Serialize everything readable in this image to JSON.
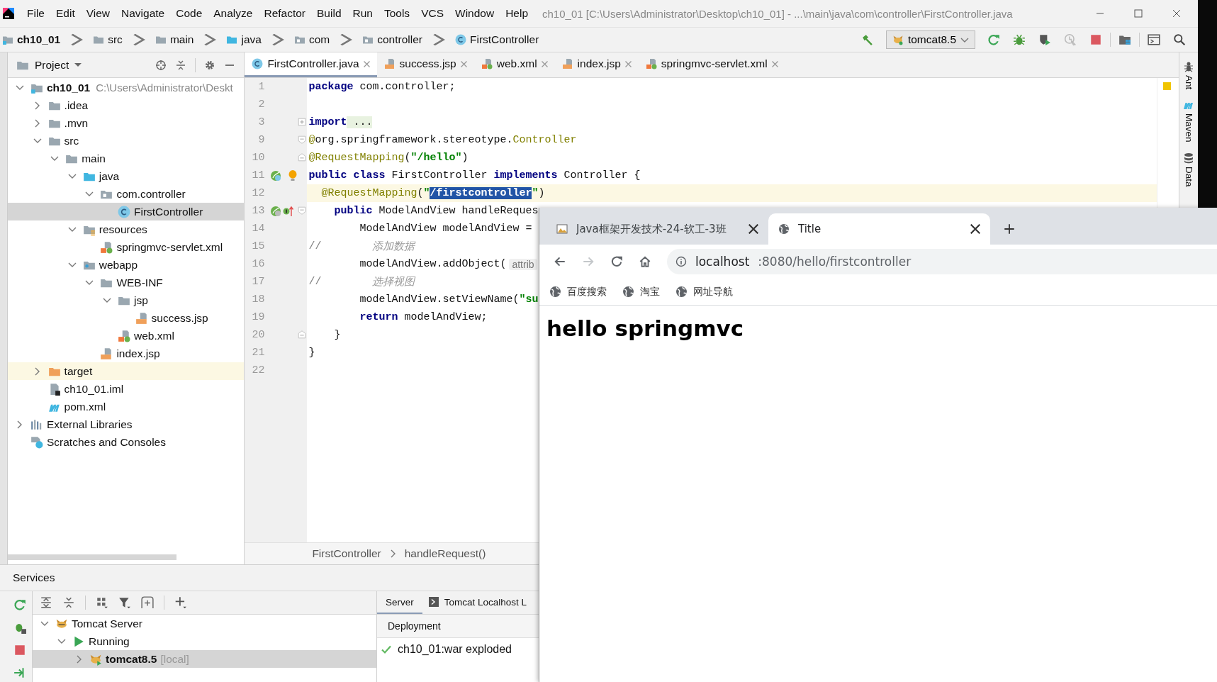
{
  "menu_bar": {
    "items": [
      "File",
      "Edit",
      "View",
      "Navigate",
      "Code",
      "Analyze",
      "Refactor",
      "Build",
      "Run",
      "Tools",
      "VCS",
      "Window",
      "Help"
    ],
    "title": "ch10_01 [C:\\Users\\Administrator\\Desktop\\ch10_01] - ...\\main\\java\\com\\controller\\FirstController.java"
  },
  "nav_bar": {
    "crumbs": [
      {
        "label": "ch10_01",
        "kind": "module"
      },
      {
        "label": "src",
        "kind": "folder"
      },
      {
        "label": "main",
        "kind": "folder"
      },
      {
        "label": "java",
        "kind": "src"
      },
      {
        "label": "com",
        "kind": "package"
      },
      {
        "label": "controller",
        "kind": "package"
      },
      {
        "label": "FirstController",
        "kind": "class"
      }
    ],
    "run_config": "tomcat8.5"
  },
  "project_panel": {
    "title": "Project",
    "tree": [
      {
        "label": "ch10_01",
        "note": "C:\\Users\\Administrator\\Deskt",
        "kind": "module",
        "expanded": true,
        "selected": false,
        "excluded": false,
        "children": [
          {
            "label": ".idea",
            "kind": "folder",
            "expanded": false,
            "selected": false,
            "excluded": false
          },
          {
            "label": ".mvn",
            "kind": "folder",
            "expanded": false,
            "selected": false,
            "excluded": false
          },
          {
            "label": "src",
            "kind": "folder",
            "expanded": true,
            "selected": false,
            "excluded": false,
            "children": [
              {
                "label": "main",
                "kind": "folder",
                "expanded": true,
                "selected": false,
                "excluded": false,
                "children": [
                  {
                    "label": "java",
                    "kind": "src",
                    "expanded": true,
                    "selected": false,
                    "excluded": false,
                    "children": [
                      {
                        "label": "com.controller",
                        "kind": "package",
                        "expanded": true,
                        "selected": false,
                        "excluded": false,
                        "children": [
                          {
                            "label": "FirstController",
                            "kind": "class",
                            "selected": true,
                            "excluded": false
                          }
                        ]
                      }
                    ]
                  },
                  {
                    "label": "resources",
                    "kind": "resources",
                    "expanded": true,
                    "selected": false,
                    "excluded": false,
                    "children": [
                      {
                        "label": "springmvc-servlet.xml",
                        "kind": "xml",
                        "selected": false,
                        "excluded": false
                      }
                    ]
                  },
                  {
                    "label": "webapp",
                    "kind": "webapp",
                    "expanded": true,
                    "selected": false,
                    "excluded": false,
                    "children": [
                      {
                        "label": "WEB-INF",
                        "kind": "folder",
                        "expanded": true,
                        "selected": false,
                        "excluded": false,
                        "children": [
                          {
                            "label": "jsp",
                            "kind": "folder",
                            "expanded": true,
                            "selected": false,
                            "excluded": false,
                            "children": [
                              {
                                "label": "success.jsp",
                                "kind": "jsp",
                                "selected": false,
                                "excluded": false
                              }
                            ]
                          },
                          {
                            "label": "web.xml",
                            "kind": "xml",
                            "selected": false,
                            "excluded": false
                          }
                        ]
                      },
                      {
                        "label": "index.jsp",
                        "kind": "jsp",
                        "selected": false,
                        "excluded": false
                      }
                    ]
                  }
                ]
              }
            ]
          },
          {
            "label": "target",
            "kind": "target",
            "expanded": false,
            "selected": false,
            "excluded": true
          },
          {
            "label": "ch10_01.iml",
            "kind": "iml",
            "selected": false,
            "excluded": false
          },
          {
            "label": "pom.xml",
            "kind": "maven",
            "selected": false,
            "excluded": false
          }
        ]
      },
      {
        "label": "External Libraries",
        "kind": "libraries",
        "expanded": false,
        "selected": false,
        "excluded": false
      },
      {
        "label": "Scratches and Consoles",
        "kind": "scratches",
        "selected": false,
        "excluded": false
      }
    ]
  },
  "editor": {
    "tabs": [
      {
        "label": "FirstController.java",
        "kind": "class",
        "selected": true
      },
      {
        "label": "success.jsp",
        "kind": "jsp",
        "selected": false
      },
      {
        "label": "web.xml",
        "kind": "xml",
        "selected": false
      },
      {
        "label": "index.jsp",
        "kind": "jsp",
        "selected": false
      },
      {
        "label": "springmvc-servlet.xml",
        "kind": "xml",
        "selected": false
      }
    ],
    "lines": [
      {
        "num": "1",
        "tokens": [
          {
            "kind": "kw",
            "text": "package"
          },
          {
            "kind": "pl",
            "text": " com.controller;"
          }
        ]
      },
      {
        "num": "2"
      },
      {
        "num": "3",
        "markers": [
          {
            "kind": "fold-plus"
          }
        ],
        "tokens": [
          {
            "kind": "kw",
            "text": "import"
          },
          {
            "kind": "folded",
            "text": " ..."
          }
        ]
      },
      {
        "num": "9",
        "markers": [
          {
            "kind": "fold-open"
          }
        ],
        "tokens": [
          {
            "kind": "ann",
            "text": "@"
          },
          {
            "kind": "pl",
            "text": "org.springframework.stereotype."
          },
          {
            "kind": "ann",
            "text": "Controller"
          }
        ]
      },
      {
        "num": "10",
        "markers": [
          {
            "kind": "fold-end"
          }
        ],
        "tokens": [
          {
            "kind": "ann",
            "text": "@RequestMapping"
          },
          {
            "kind": "pl",
            "text": "("
          },
          {
            "kind": "str",
            "text": "\"/hello\""
          },
          {
            "kind": "pl",
            "text": ")"
          }
        ]
      },
      {
        "num": "11",
        "bulb": true,
        "markers": [
          {
            "kind": "bean"
          }
        ],
        "tokens": [
          {
            "kind": "kw",
            "text": "public"
          },
          {
            "kind": "kw",
            "text": " class"
          },
          {
            "kind": "pl",
            "text": " FirstController "
          },
          {
            "kind": "kw",
            "text": "implements"
          },
          {
            "kind": "pl",
            "text": " Controller {"
          }
        ]
      },
      {
        "num": "12",
        "current": true,
        "tokens": [
          {
            "kind": "ann",
            "text": "  @RequestMapping"
          },
          {
            "kind": "pl",
            "text": "("
          },
          {
            "kind": "str",
            "text": "\""
          },
          {
            "kind": "sel",
            "text": "/firstcontroller"
          },
          {
            "kind": "str",
            "text": "\""
          },
          {
            "kind": "pl",
            "text": ")"
          }
        ]
      },
      {
        "num": "13",
        "markers": [
          {
            "kind": "bean-impl"
          },
          {
            "kind": "implements"
          },
          {
            "kind": "fold-open"
          }
        ],
        "tokens": [
          {
            "kind": "kw",
            "text": "    public"
          },
          {
            "kind": "pl",
            "text": " ModelAndView handleReques"
          }
        ]
      },
      {
        "num": "14",
        "tokens": [
          {
            "kind": "pl",
            "text": "        ModelAndView modelAndView ="
          }
        ]
      },
      {
        "num": "15",
        "tokens": [
          {
            "kind": "cmt",
            "text": "//        "
          },
          {
            "kind": "cmtcn",
            "text": "添加数据"
          }
        ]
      },
      {
        "num": "16",
        "tokens": [
          {
            "kind": "pl",
            "text": "        modelAndView.addObject("
          },
          {
            "kind": "hint",
            "text": "attrib"
          }
        ]
      },
      {
        "num": "17",
        "tokens": [
          {
            "kind": "cmt",
            "text": "//        "
          },
          {
            "kind": "cmtcn",
            "text": "选择视图"
          }
        ]
      },
      {
        "num": "18",
        "tokens": [
          {
            "kind": "pl",
            "text": "        modelAndView.setViewName("
          },
          {
            "kind": "str",
            "text": "\"su"
          }
        ]
      },
      {
        "num": "19",
        "tokens": [
          {
            "kind": "kw",
            "text": "        return"
          },
          {
            "kind": "pl",
            "text": " modelAndView;"
          }
        ]
      },
      {
        "num": "20",
        "markers": [
          {
            "kind": "fold-end"
          }
        ],
        "tokens": [
          {
            "kind": "pl",
            "text": "    }"
          }
        ]
      },
      {
        "num": "21",
        "tokens": [
          {
            "kind": "pl",
            "text": "}"
          }
        ]
      },
      {
        "num": "22"
      }
    ],
    "breadcrumb": [
      "FirstController",
      "handleRequest()"
    ]
  },
  "side_tools": [
    {
      "label": "Ant",
      "kind": "ant"
    },
    {
      "label": "Maven",
      "kind": "maven"
    },
    {
      "label": "Data",
      "kind": "database"
    }
  ],
  "services": {
    "title": "Services",
    "tree": [
      {
        "label": "Tomcat Server",
        "kind": "tomcat",
        "expanded": true,
        "selected": false,
        "children": [
          {
            "label": "Running",
            "kind": "run",
            "expanded": true,
            "selected": false,
            "children": [
              {
                "label": "tomcat8.5",
                "note": "[local]",
                "kind": "tomcat-run",
                "expanded": false,
                "selected": true
              }
            ]
          }
        ]
      }
    ],
    "tabs": [
      {
        "label": "Server",
        "kind": "plain",
        "selected": true
      },
      {
        "label": "Tomcat Localhost L",
        "kind": "console",
        "selected": false
      }
    ],
    "deployment_header": "Deployment",
    "deployments": [
      "ch10_01:war exploded"
    ]
  },
  "browser": {
    "tabs": [
      {
        "title": "Java框架开发技术-24-软工-3班",
        "kind": "picture",
        "selected": false
      },
      {
        "title": "Title",
        "kind": "globe",
        "selected": true
      }
    ],
    "address_host": "localhost",
    "address_path": ":8080/hello/firstcontroller",
    "bookmarks": [
      "百度搜索",
      "淘宝",
      "网址导航"
    ],
    "heading": "hello springmvc"
  }
}
